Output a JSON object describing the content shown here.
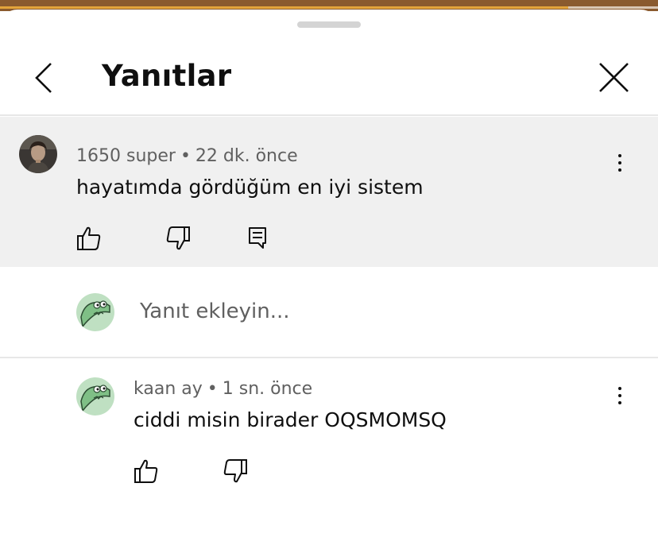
{
  "header": {
    "title": "Yanıtlar"
  },
  "parent_comment": {
    "author": "1650 super",
    "separator": "•",
    "time": "22 dk. önce",
    "text": "hayatımda gördüğüm en iyi sistem"
  },
  "reply_box": {
    "placeholder": "Yanıt ekleyin..."
  },
  "replies": [
    {
      "author": "kaan ay",
      "separator": "•",
      "time": "1 sn. önce",
      "text": "ciddi misin birader OQSMOMSQ"
    }
  ],
  "colors": {
    "parent_bg": "#f0f0f0",
    "meta_text": "#606060",
    "primary_text": "#0f0f0f"
  }
}
